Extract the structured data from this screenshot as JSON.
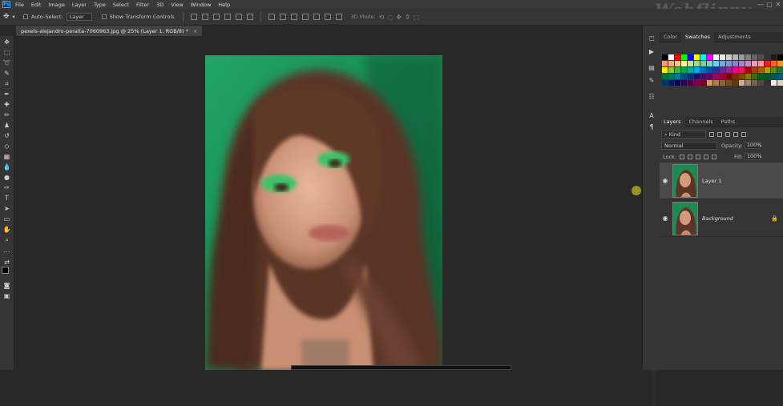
{
  "app": {
    "logo_text": "Ps"
  },
  "menu": [
    "File",
    "Edit",
    "Image",
    "Layer",
    "Type",
    "Select",
    "Filter",
    "3D",
    "View",
    "Window",
    "Help"
  ],
  "watermark": "Webflippy",
  "window_buttons": [
    "—",
    "▢",
    "✕"
  ],
  "options_bar": {
    "auto_select_label": "Auto-Select:",
    "auto_select_value": "Layer",
    "show_transform_label": "Show Transform Controls",
    "mode_3d_label": "3D Mode:"
  },
  "document_tab": {
    "title": "pexels-alejandro-peralta-7060963.jpg @ 25% (Layer 1, RGB/8) *",
    "close": "×"
  },
  "panels": {
    "top_tabs": [
      "Color",
      "Swatches",
      "Adjustments"
    ],
    "top_active": "Swatches",
    "layers_tabs": [
      "Layers",
      "Channels",
      "Paths"
    ],
    "layers_active": "Layers",
    "kind_label": "⌕ Kind",
    "blend_mode": "Normal",
    "opacity_label": "Opacity:",
    "opacity_value": "100%",
    "lock_label": "Lock:",
    "fill_label": "Fill:",
    "fill_value": "100%"
  },
  "layers": [
    {
      "name": "Layer 1",
      "selected": true,
      "italic": false
    },
    {
      "name": "Background",
      "selected": false,
      "italic": true
    }
  ],
  "swatch_colors": [
    [
      "#000000",
      "#ffffff",
      "#ff0000",
      "#00ff00",
      "#0000ff",
      "#ffff00",
      "#00ffff",
      "#ff00ff",
      "#ffffff",
      "#e6e6e6",
      "#cccccc",
      "#b3b3b3",
      "#999999",
      "#808080",
      "#666666",
      "#4d4d4d",
      "#333333",
      "#1a1a1a",
      "#000000"
    ],
    [
      "#f7977a",
      "#f9ad81",
      "#fdc68a",
      "#fff79a",
      "#c4df9b",
      "#a2d39c",
      "#82ca9d",
      "#7bcdc8",
      "#6ecff6",
      "#7ea7d8",
      "#8493ca",
      "#8882be",
      "#a187be",
      "#bc8dbf",
      "#f49ac2",
      "#f6989d",
      "#ed1c24",
      "#f26522",
      "#f7941d"
    ],
    [
      "#fff200",
      "#8dc63f",
      "#39b54a",
      "#00a651",
      "#00a99d",
      "#00aeef",
      "#0072bc",
      "#0054a6",
      "#2e3192",
      "#662d91",
      "#92278f",
      "#ec008c",
      "#ed145b",
      "#9e0b0f",
      "#a0410d",
      "#a3620a",
      "#aba000",
      "#598527",
      "#1a7b30"
    ],
    [
      "#007236",
      "#00746b",
      "#0076a3",
      "#004b80",
      "#003471",
      "#1b1464",
      "#440e62",
      "#630460",
      "#9e005d",
      "#9e0039",
      "#790000",
      "#7b2e00",
      "#7d4900",
      "#827b00",
      "#406618",
      "#005e20",
      "#005826",
      "#005952",
      "#005b7f"
    ],
    [
      "#003663",
      "#002157",
      "#0d004c",
      "#32004b",
      "#4b0049",
      "#7b0046",
      "#7a0026",
      "#c69c6d",
      "#a67c52",
      "#8c6239",
      "#754c24",
      "#603913",
      "#c7b299",
      "#998675",
      "#736357",
      "#534741",
      "#362f2d",
      "#efebe4",
      "#dcd3c5"
    ]
  ]
}
